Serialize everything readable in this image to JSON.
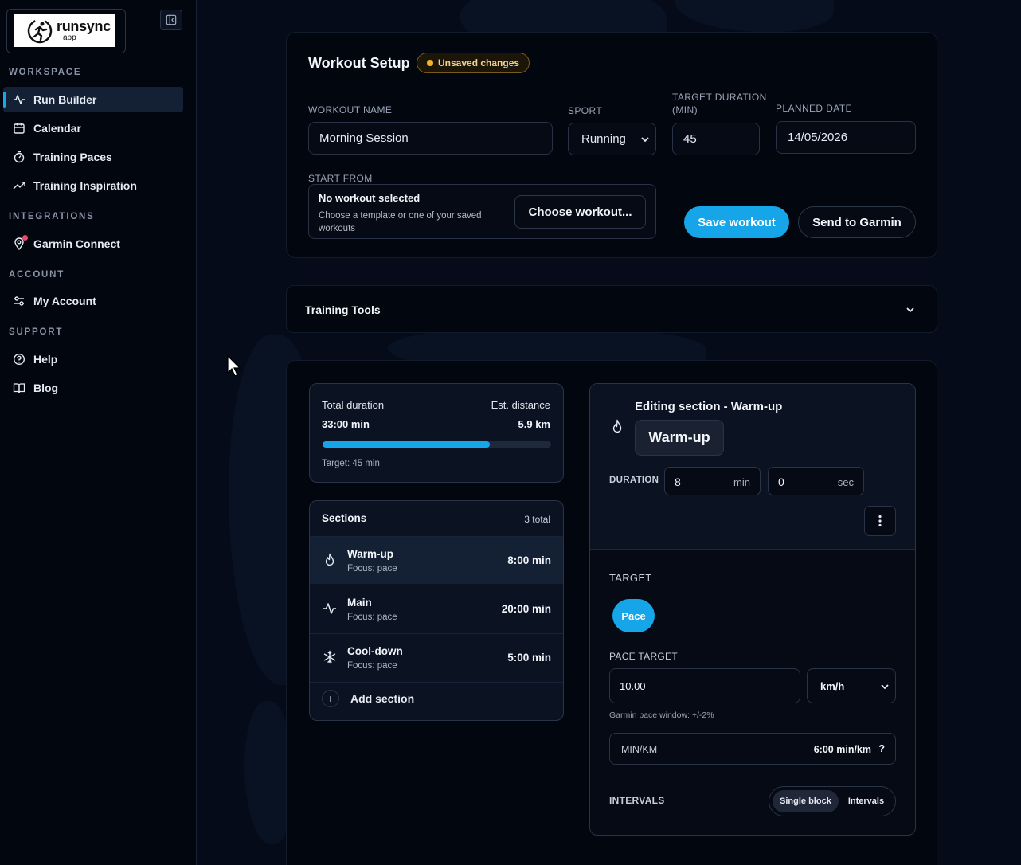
{
  "brand": {
    "name": "runsync",
    "sub": "app"
  },
  "sidebar": {
    "sections": [
      {
        "heading": "WORKSPACE",
        "items": [
          {
            "label": "Run Builder",
            "icon": "activity-icon",
            "active": true
          },
          {
            "label": "Calendar",
            "icon": "calendar-icon"
          },
          {
            "label": "Training Paces",
            "icon": "timer-icon"
          },
          {
            "label": "Training Inspiration",
            "icon": "trending-up-icon"
          }
        ]
      },
      {
        "heading": "INTEGRATIONS",
        "items": [
          {
            "label": "Garmin Connect",
            "icon": "location-icon",
            "notification": true
          }
        ]
      },
      {
        "heading": "ACCOUNT",
        "items": [
          {
            "label": "My Account",
            "icon": "sliders-icon"
          }
        ]
      },
      {
        "heading": "SUPPORT",
        "items": [
          {
            "label": "Help",
            "icon": "help-circle-icon"
          },
          {
            "label": "Blog",
            "icon": "book-icon"
          }
        ]
      }
    ]
  },
  "setup": {
    "title": "Workout Setup",
    "badge": "Unsaved changes",
    "workout_name_label": "WORKOUT NAME",
    "workout_name_value": "Morning Session",
    "sport_label": "SPORT",
    "sport_value": "Running",
    "target_duration_label": "TARGET DURATION (MIN)",
    "target_duration_value": "45",
    "planned_date_label": "PLANNED DATE",
    "planned_date_value": "14/05/2026",
    "start_from_label": "START FROM",
    "start_title": "No workout selected",
    "start_sub": "Choose a template or one of your saved workouts",
    "choose_button": "Choose workout...",
    "save_button": "Save workout",
    "send_button": "Send to Garmin"
  },
  "tools": {
    "title": "Training Tools"
  },
  "summary": {
    "total_label": "Total duration",
    "total_value": "33:00 min",
    "distance_label": "Est. distance",
    "distance_value": "5.9 km",
    "progress_fraction": 0.733,
    "target_text": "Target: 45 min"
  },
  "sections": {
    "title": "Sections",
    "count": "3 total",
    "items": [
      {
        "name": "Warm-up",
        "focus": "Focus: pace",
        "duration": "8:00 min",
        "icon": "flame-icon",
        "active": true
      },
      {
        "name": "Main",
        "focus": "Focus: pace",
        "duration": "20:00 min",
        "icon": "activity-icon"
      },
      {
        "name": "Cool-down",
        "focus": "Focus: pace",
        "duration": "5:00 min",
        "icon": "snowflake-icon"
      }
    ],
    "add_label": "Add section"
  },
  "editor": {
    "heading": "Editing section - Warm-up",
    "chip": "Warm-up",
    "duration_label": "DURATION",
    "minutes": "8",
    "min_unit": "min",
    "seconds": "0",
    "sec_unit": "sec",
    "target_label": "TARGET",
    "target_pill": "Pace",
    "pace_target_label": "PACE TARGET",
    "pace_value": "10.00",
    "pace_unit": "km/h",
    "pace_hint": "Garmin pace window: +/-2%",
    "minkm_label": "MIN/KM",
    "minkm_value": "6:00 min/km",
    "minkm_help": "?",
    "intervals_label": "INTERVALS",
    "seg_single": "Single block",
    "seg_intervals": "Intervals"
  },
  "colors": {
    "accent": "#15a5e8",
    "warning": "#f0b429",
    "notification": "#f0476a",
    "background": "#050b18"
  }
}
